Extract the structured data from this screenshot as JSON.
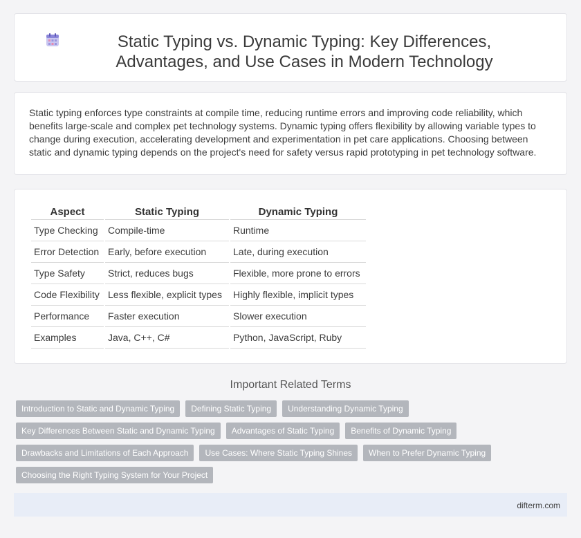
{
  "header": {
    "icon": "calendar-icon",
    "title": "Static Typing vs. Dynamic Typing: Key Differences, Advantages, and Use Cases in Modern Technology"
  },
  "intro": {
    "text": "Static typing enforces type constraints at compile time, reducing runtime errors and improving code reliability, which benefits large-scale and complex pet technology systems. Dynamic typing offers flexibility by allowing variable types to change during execution, accelerating development and experimentation in pet care applications. Choosing between static and dynamic typing depends on the project's need for safety versus rapid prototyping in pet technology software."
  },
  "comparison": {
    "headers": [
      "Aspect",
      "Static Typing",
      "Dynamic Typing"
    ],
    "rows": [
      [
        "Type Checking",
        "Compile-time",
        "Runtime"
      ],
      [
        "Error Detection",
        "Early, before execution",
        "Late, during execution"
      ],
      [
        "Type Safety",
        "Strict, reduces bugs",
        "Flexible, more prone to errors"
      ],
      [
        "Code Flexibility",
        "Less flexible, explicit types",
        "Highly flexible, implicit types"
      ],
      [
        "Performance",
        "Faster execution",
        "Slower execution"
      ],
      [
        "Examples",
        "Java, C++, C#",
        "Python, JavaScript, Ruby"
      ]
    ]
  },
  "related": {
    "title": "Important Related Terms",
    "tags": [
      [
        "Introduction to Static and Dynamic Typing",
        "Defining Static Typing",
        "Understanding Dynamic Typing"
      ],
      [
        "Key Differences Between Static and Dynamic Typing",
        "Advantages of Static Typing",
        "Benefits of Dynamic Typing"
      ],
      [
        "Drawbacks and Limitations of Each Approach",
        "Use Cases: Where Static Typing Shines",
        "When to Prefer Dynamic Typing"
      ],
      [
        "Choosing the Right Typing System for Your Project"
      ]
    ]
  },
  "footer": {
    "site": "difterm.com"
  },
  "colors": {
    "tag_bg": "#b3b6bc",
    "footer_bg": "#e8edf7",
    "page_bg": "#f4f4f6"
  }
}
